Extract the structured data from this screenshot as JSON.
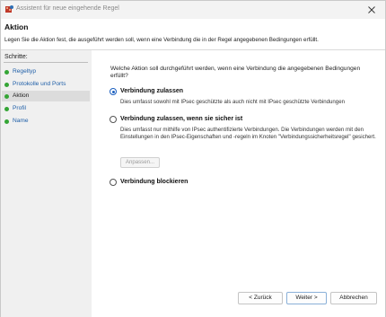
{
  "window": {
    "title": "Assistent für neue eingehende Regel"
  },
  "header": {
    "title": "Aktion",
    "subtitle": "Legen Sie die Aktion fest, die ausgeführt werden soll, wenn eine Verbindung die in der Regel angegebenen Bedingungen erfüllt."
  },
  "sidebar": {
    "heading": "Schritte:",
    "steps": [
      {
        "label": "Regeltyp",
        "active": false
      },
      {
        "label": "Protokolle und Ports",
        "active": false
      },
      {
        "label": "Aktion",
        "active": true
      },
      {
        "label": "Profil",
        "active": false
      },
      {
        "label": "Name",
        "active": false
      }
    ]
  },
  "main": {
    "question": "Welche Aktion soll durchgeführt werden, wenn eine Verbindung die angegebenen Bedingungen erfüllt?",
    "options": [
      {
        "label": "Verbindung zulassen",
        "description": "Dies umfasst sowohl mit IPsec geschützte als auch nicht mit IPsec geschützte Verbindungen",
        "selected": true
      },
      {
        "label": "Verbindung zulassen, wenn sie sicher ist",
        "description": "Dies umfasst nur mithilfe von IPsec authentifizierte Verbindungen. Die Verbindungen werden mit den Einstellungen in den IPsec-Eigenschaften und -regeln im Knoten \"Verbindungssicherheitsregel\" gesichert.",
        "selected": false
      },
      {
        "label": "Verbindung blockieren",
        "description": "",
        "selected": false
      }
    ],
    "customize_label": "Anpassen..."
  },
  "footer": {
    "back_label": "< Zurück",
    "next_label": "Weiter >",
    "cancel_label": "Abbrechen"
  },
  "colors": {
    "accent": "#1b5fbf",
    "step_dot": "#34a535",
    "link": "#1f5fa8",
    "sidebar_bg": "#f0f0f0"
  },
  "icons": {
    "app": "firewall-rule-icon",
    "close": "close-icon",
    "step": "green-dot-icon"
  }
}
